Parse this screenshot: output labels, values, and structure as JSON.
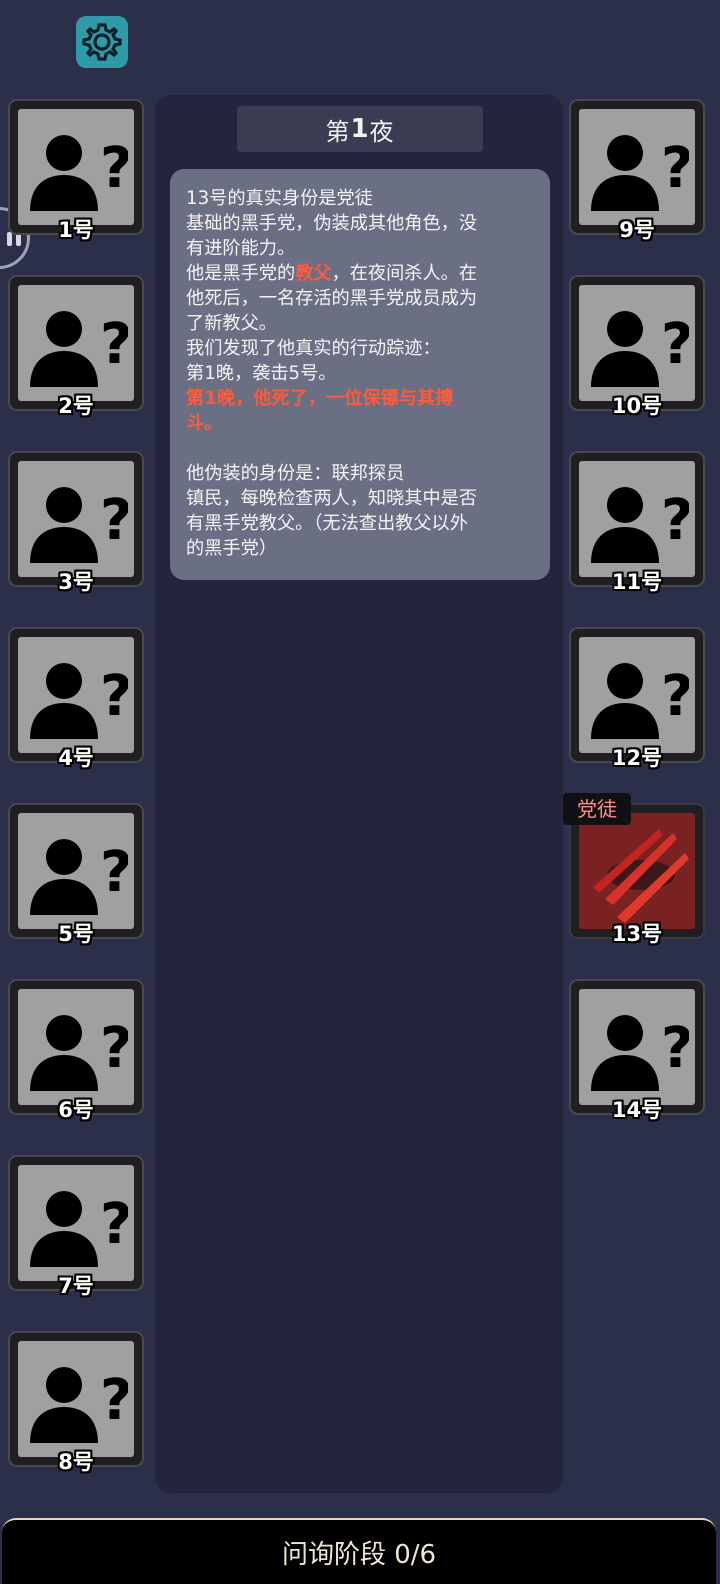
{
  "night": {
    "prefix": "第",
    "number": "1",
    "suffix": "夜"
  },
  "info": {
    "l1": "13号的真实身份是党徒",
    "l2": "基础的黑手党，伪装成其他角色，没",
    "l3": "有进阶能力。",
    "l4a": "他是黑手党的",
    "l4b": "教父",
    "l4c": "，在夜间杀人。在",
    "l5": "他死后，一名存活的黑手党成员成为",
    "l6": "了新教父。",
    "l7": "我们发现了他真实的行动踪迹：",
    "l8": "第1晚，袭击5号。",
    "l9": "第1晚，他死了，一位保镖与其搏",
    "l10": "斗。",
    "l11": "他伪装的身份是：联邦探员",
    "l12": "镇民，每晚检查两人，知晓其中是否",
    "l13": "有黑手党教父。（无法查出教父以外",
    "l14": "的黑手党）"
  },
  "players": {
    "p1": "1号",
    "p2": "2号",
    "p3": "3号",
    "p4": "4号",
    "p5": "5号",
    "p6": "6号",
    "p7": "7号",
    "p8": "8号",
    "p9": "9号",
    "p10": "10号",
    "p11": "11号",
    "p12": "12号",
    "p13": "13号",
    "p13_role": "党徒",
    "p14": "14号"
  },
  "phase": "问询阶段 0/6",
  "icons": {
    "settings": "gear-icon",
    "unknown": "unknown-player-icon",
    "dead": "claw-slash-icon"
  },
  "colors": {
    "background": "#2b2f4a",
    "panel": "#23253c",
    "card": "#6b6f83",
    "highlight": "#ff5a3a",
    "settings": "#2f9aa8"
  }
}
